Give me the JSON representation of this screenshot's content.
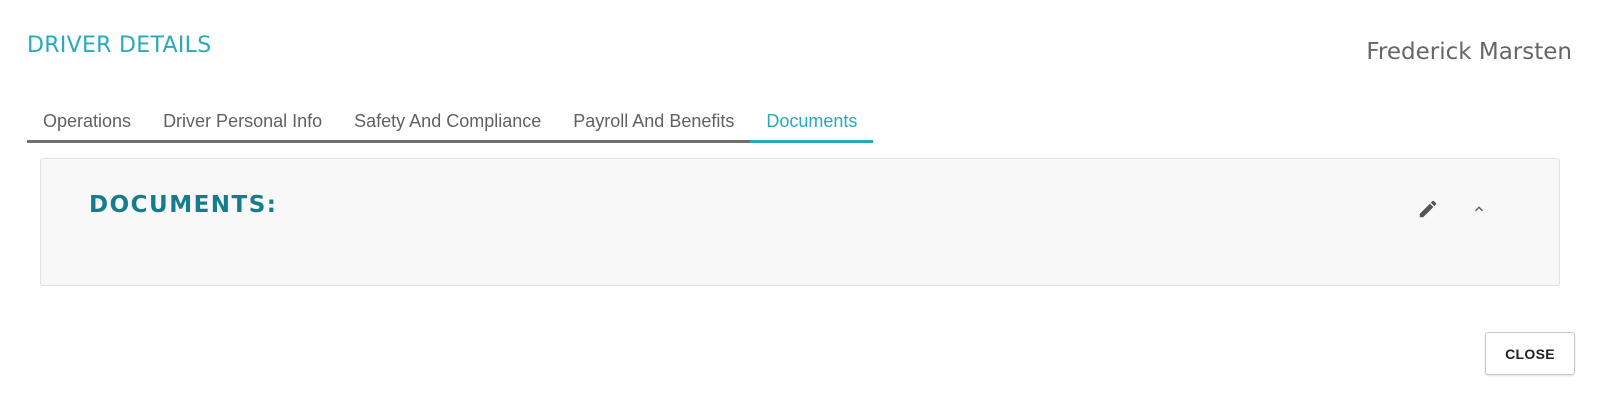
{
  "header": {
    "title": "DRIVER DETAILS",
    "driver_name": "Frederick Marsten"
  },
  "tabs": [
    {
      "label": "Operations",
      "active": false
    },
    {
      "label": "Driver Personal Info",
      "active": false
    },
    {
      "label": "Safety And Compliance",
      "active": false
    },
    {
      "label": "Payroll And Benefits",
      "active": false
    },
    {
      "label": "Documents",
      "active": true
    }
  ],
  "panel": {
    "title": "DOCUMENTS:",
    "edit_icon": "pencil-icon",
    "collapse_icon": "chevron-up-icon"
  },
  "footer": {
    "close_label": "CLOSE"
  },
  "colors": {
    "accent": "#29a9bd",
    "panel_title": "#137d8e",
    "tab_text": "#616161",
    "tab_underline": "#707070",
    "panel_bg": "#f8f8f8"
  }
}
